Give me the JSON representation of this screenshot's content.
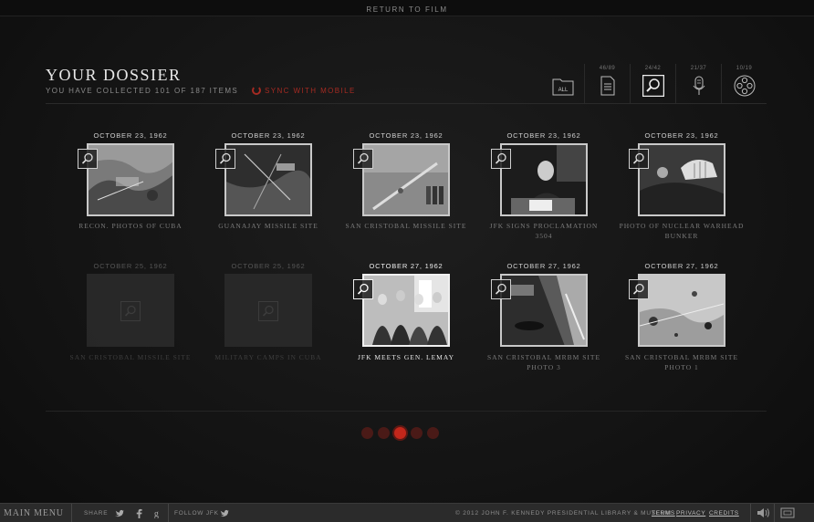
{
  "top_link": "RETURN TO FILM",
  "header": {
    "title": "YOUR DOSSIER",
    "subtitle": "YOU HAVE COLLECTED 101 OF 187 ITEMS",
    "sync": "SYNC WITH MOBILE"
  },
  "filters": [
    {
      "label": "ALL",
      "count": "",
      "icon": "folder-icon"
    },
    {
      "label": "",
      "count": "46/89",
      "icon": "document-icon"
    },
    {
      "label": "",
      "count": "24/42",
      "icon": "magnifier-icon"
    },
    {
      "label": "",
      "count": "21/37",
      "icon": "microphone-icon"
    },
    {
      "label": "",
      "count": "10/19",
      "icon": "film-reel-icon"
    }
  ],
  "items": [
    {
      "date": "OCTOBER 23, 1962",
      "caption": "RECON. PHOTOS OF CUBA",
      "state": "collected"
    },
    {
      "date": "OCTOBER 23, 1962",
      "caption": "GUANAJAY MISSILE SITE",
      "state": "collected"
    },
    {
      "date": "OCTOBER 23, 1962",
      "caption": "SAN CRISTOBAL MISSILE SITE",
      "state": "collected"
    },
    {
      "date": "OCTOBER 23, 1962",
      "caption": "JFK SIGNS PROCLAMATION 3504",
      "state": "collected"
    },
    {
      "date": "OCTOBER 23, 1962",
      "caption": "PHOTO OF NUCLEAR WARHEAD BUNKER",
      "state": "collected"
    },
    {
      "date": "OCTOBER 25, 1962",
      "caption": "SAN CRISTOBAL MISSILE SITE",
      "state": "locked"
    },
    {
      "date": "OCTOBER 25, 1962",
      "caption": "MILITARY CAMPS IN CUBA",
      "state": "locked"
    },
    {
      "date": "OCTOBER 27, 1962",
      "caption": "JFK MEETS GEN. LEMAY",
      "state": "selected"
    },
    {
      "date": "OCTOBER 27, 1962",
      "caption": "SAN CRISTOBAL MRBM SITE PHOTO 3",
      "state": "collected"
    },
    {
      "date": "OCTOBER 27, 1962",
      "caption": "SAN CRISTOBAL MRBM SITE PHOTO 1",
      "state": "collected"
    }
  ],
  "pager": {
    "pages": 5,
    "current": 3
  },
  "footer": {
    "main_menu": "MAIN MENU",
    "share": "SHARE",
    "follow": "FOLLOW JFK",
    "copyright": "© 2012 JOHN F. KENNEDY PRESIDENTIAL LIBRARY & MUSEUM",
    "links": [
      "TERMS",
      "PRIVACY",
      "CREDITS"
    ]
  },
  "colors": {
    "accent": "#c2271b",
    "background": "#141414",
    "text": "#cccccc"
  }
}
